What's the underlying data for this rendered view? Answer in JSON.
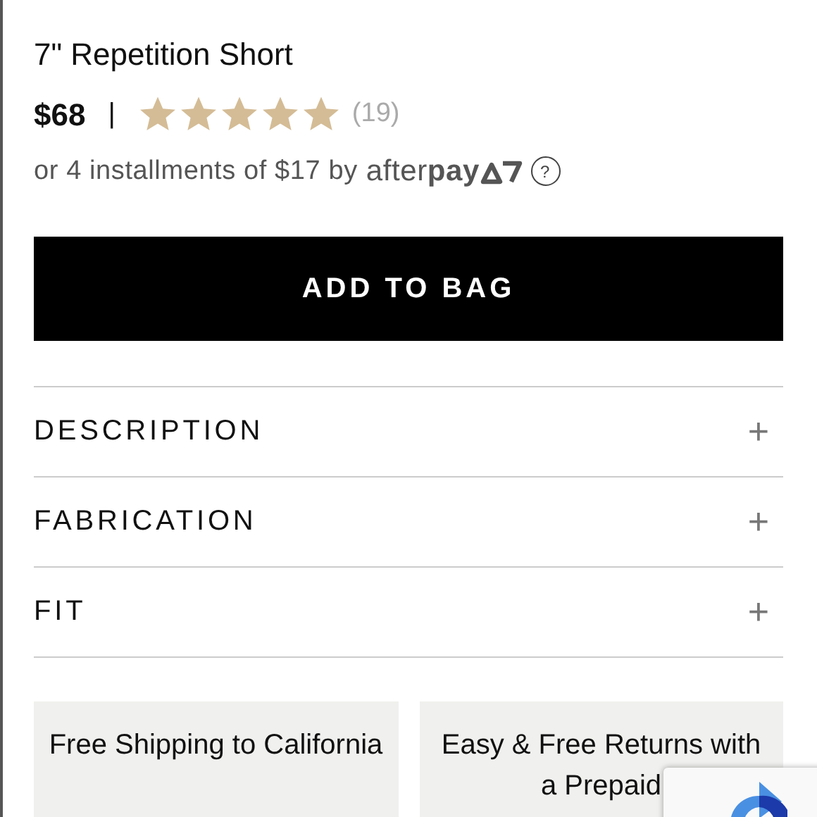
{
  "product": {
    "title": "7\" Repetition Short",
    "price": "$68",
    "separator": "|",
    "stars": 5,
    "review_count": "(19)"
  },
  "installments": {
    "text": "or 4 installments of $17 by",
    "provider": "after**pay**",
    "help": "?"
  },
  "add_button": "ADD TO BAG",
  "accordion": [
    {
      "label": "DESCRIPTION",
      "expanded": false,
      "toggle": "+"
    },
    {
      "label": "FABRICATION",
      "expanded": false,
      "toggle": "+"
    },
    {
      "label": "FIT",
      "expanded": false,
      "toggle": "+"
    }
  ],
  "perks": [
    "Free Shipping to California",
    "Easy & Free Returns with a Prepaid"
  ]
}
